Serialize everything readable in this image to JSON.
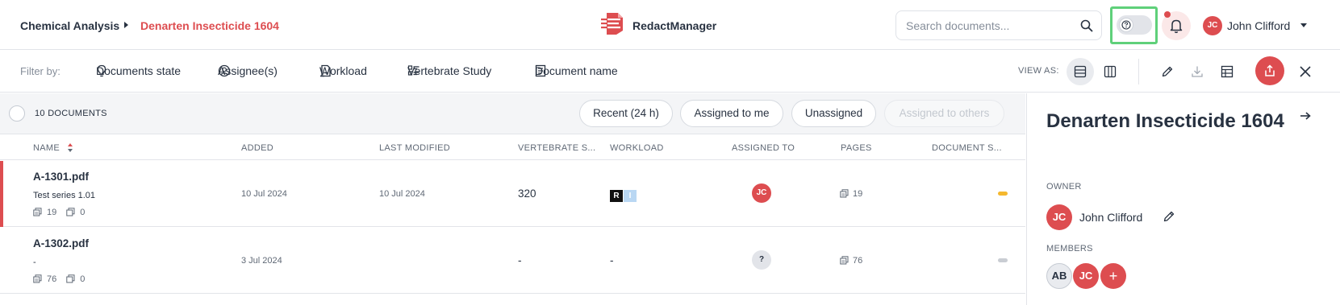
{
  "breadcrumb": {
    "project": "Chemical Analysis",
    "dossier": "Denarten Insecticide 1604"
  },
  "app": {
    "name": "RedactManager"
  },
  "search": {
    "placeholder": "Search documents..."
  },
  "user": {
    "initials": "JC",
    "name": "John Clifford"
  },
  "colors": {
    "accent": "#dd4d50",
    "highlight": "#5fd07a",
    "state_warning": "#f5b82e",
    "state_new": "#c9cdd3"
  },
  "filters": {
    "label": "Filter by:",
    "items": [
      "Documents state",
      "Assignee(s)",
      "Workload",
      "Vertebrate Study",
      "Document name"
    ]
  },
  "view_as": {
    "label": "VIEW AS:"
  },
  "list": {
    "count_label": "10 DOCUMENTS",
    "quick_filters": [
      "Recent (24 h)",
      "Assigned to me",
      "Unassigned",
      "Assigned to others"
    ],
    "columns": [
      "NAME",
      "ADDED",
      "LAST MODIFIED",
      "VERTEBRATE S...",
      "WORKLOAD",
      "ASSIGNED TO",
      "PAGES",
      "DOCUMENT S..."
    ],
    "rows": [
      {
        "name": "A-1301.pdf",
        "subtitle": "Test series 1.01",
        "pages_icon_count": "19",
        "copies": "0",
        "added": "10 Jul 2024",
        "modified": "10 Jul 2024",
        "vertebrate": "320",
        "workload": [
          "R",
          "I"
        ],
        "assignee": "JC",
        "pages": "19"
      },
      {
        "name": "A-1302.pdf",
        "subtitle": "-",
        "pages_icon_count": "76",
        "copies": "0",
        "added": "3 Jul 2024",
        "modified": "",
        "vertebrate": "-",
        "workload_text": "-",
        "assignee": "?",
        "pages": "76"
      }
    ]
  },
  "side": {
    "title": "Denarten Insecticide 1604",
    "owner_label": "OWNER",
    "owner_initials": "JC",
    "owner_name": "John Clifford",
    "members_label": "MEMBERS",
    "members": [
      "AB",
      "JC",
      "+"
    ]
  }
}
